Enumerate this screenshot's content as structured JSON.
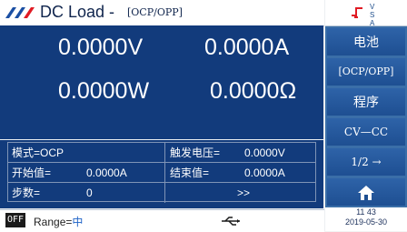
{
  "header": {
    "title": "DC Load -",
    "mode": "[OCP/OPP]",
    "brand_color": "#1b4fa3",
    "status_icons": [
      "trigger-icon",
      "vsa-indicator"
    ],
    "indicator_text": [
      "V",
      "S",
      "A"
    ]
  },
  "measurements": {
    "voltage": "0.0000V",
    "current": "0.0000A",
    "power": "0.0000W",
    "resistance": "0.0000Ω"
  },
  "params": {
    "mode_label": "模式=OCP",
    "trigger_voltage_label": "触发电压=",
    "trigger_voltage_value": "0.0000V",
    "start_label": "开始值=",
    "start_value": "0.0000A",
    "end_label": "结束值=",
    "end_value": "0.0000A",
    "steps_label": "步数=",
    "steps_value": "0",
    "more_label": ">>"
  },
  "bottom": {
    "output_state": "OFF",
    "range_label": "Range=",
    "range_value": "中",
    "usb_icon": "usb-icon"
  },
  "sidebar": {
    "buttons": [
      "电池",
      "[OCP/OPP]",
      "程序",
      "CV—CC",
      "1/2  →",
      "home-icon"
    ]
  },
  "clock": {
    "time": "11 43",
    "date": "2019-05-30"
  }
}
